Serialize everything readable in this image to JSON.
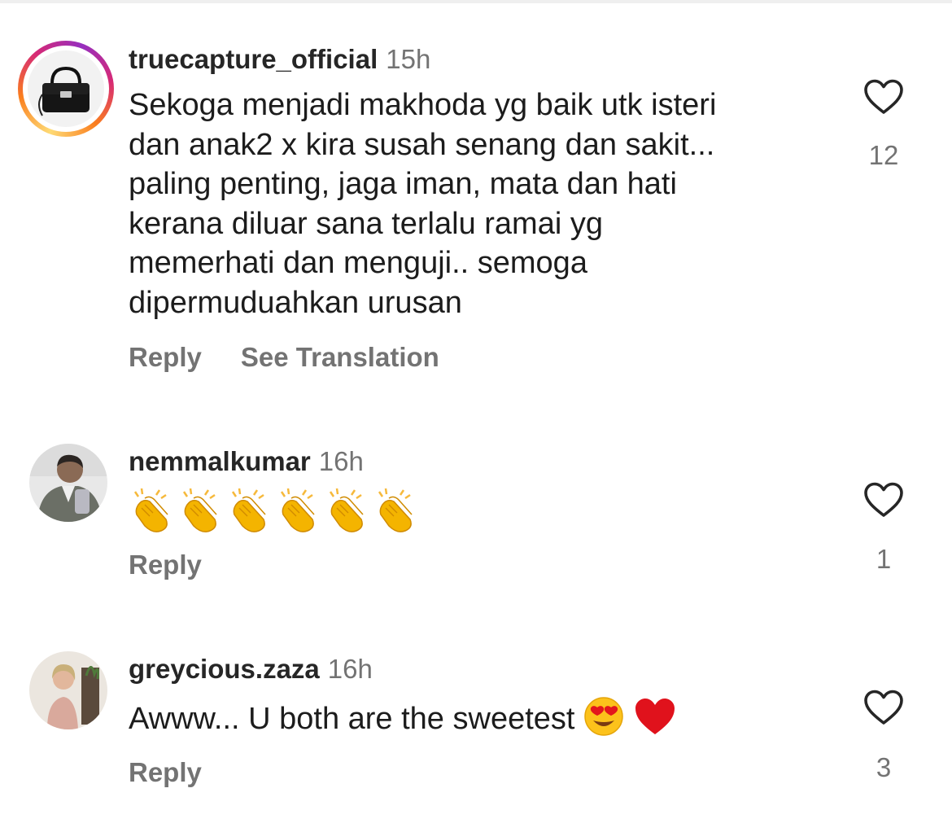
{
  "comments": [
    {
      "username": "truecapture_official",
      "time": "15h",
      "text": "Sekoga menjadi makhoda yg baik utk isteri\ndan anak2 x kira susah senang dan sakit...\npaling penting, jaga iman, mata dan hati\nkerana diluar sana terlalu ramai yg\nmemerhati dan menguji.. semoga\ndipermuduahkan urusan",
      "reply_label": "Reply",
      "translation_label": "See Translation",
      "like_count": "12",
      "avatar_icon": "handbag-avatar",
      "has_story_ring": true
    },
    {
      "username": "nemmalkumar",
      "time": "16h",
      "emojis": [
        "clapping-hands-emoji",
        "clapping-hands-emoji",
        "clapping-hands-emoji",
        "clapping-hands-emoji",
        "clapping-hands-emoji",
        "clapping-hands-emoji"
      ],
      "reply_label": "Reply",
      "like_count": "1",
      "avatar_icon": "man-in-suit-avatar"
    },
    {
      "username": "greycious.zaza",
      "time": "16h",
      "text": "Awww... U both are the sweetest",
      "emojis": [
        "heart-eyes-emoji",
        "red-heart-emoji"
      ],
      "reply_label": "Reply",
      "like_count": "3",
      "avatar_icon": "woman-avatar"
    }
  ],
  "colors": {
    "primary_text": "#262626",
    "secondary_text": "#737373",
    "background": "#ffffff"
  }
}
